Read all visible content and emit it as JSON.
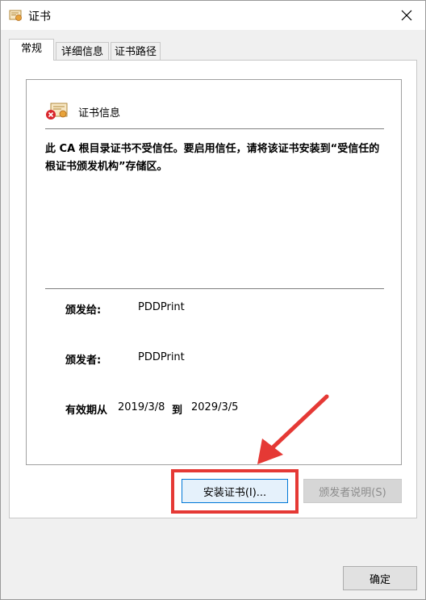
{
  "window": {
    "title": "证书"
  },
  "tabs": [
    {
      "label": "常规",
      "active": true
    },
    {
      "label": "详细信息",
      "active": false
    },
    {
      "label": "证书路径",
      "active": false
    }
  ],
  "info": {
    "title": "证书信息",
    "message": "此 CA 根目录证书不受信任。要启用信任，请将该证书安装到“受信任的根证书颁发机构”存储区。",
    "issued_to_label": "颁发给:",
    "issued_to_value": "PDDPrint",
    "issued_by_label": "颁发者:",
    "issued_by_value": "PDDPrint",
    "valid_from_label": "有效期从",
    "valid_from": "2019/3/8",
    "valid_to_label": "到",
    "valid_to": "2029/3/5"
  },
  "buttons": {
    "install": "安装证书(I)...",
    "issuer_statement": "颁发者说明(S)",
    "ok": "确定"
  },
  "colors": {
    "highlight": "#e53935",
    "focus_border": "#0078d7"
  }
}
